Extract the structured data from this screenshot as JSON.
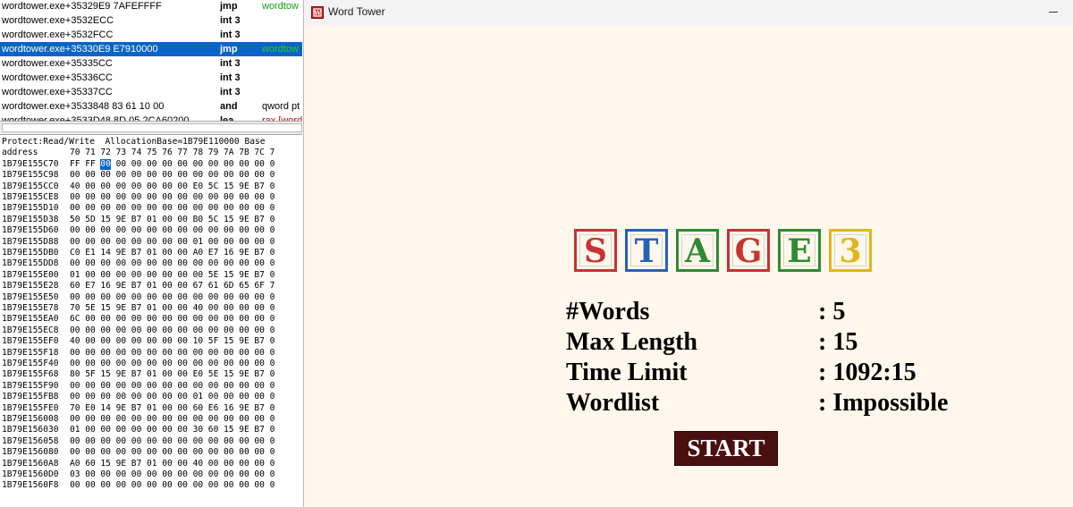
{
  "disassembly": {
    "rows": [
      {
        "address": "wordtower.exe+35329E9 7AFEFFFF",
        "opcode": "jmp",
        "operand": "wordtow",
        "operand_color": "green"
      },
      {
        "address": "wordtower.exe+3532ECC",
        "opcode": "int 3",
        "operand": ""
      },
      {
        "address": "wordtower.exe+3532FCC",
        "opcode": "int 3",
        "operand": ""
      },
      {
        "address": "wordtower.exe+35330E9 E7910000",
        "opcode": "jmp",
        "operand": "wordtow",
        "operand_color": "green",
        "selected": true
      },
      {
        "address": "wordtower.exe+35335CC",
        "opcode": "int 3",
        "operand": ""
      },
      {
        "address": "wordtower.exe+35336CC",
        "opcode": "int 3",
        "operand": ""
      },
      {
        "address": "wordtower.exe+35337CC",
        "opcode": "int 3",
        "operand": ""
      },
      {
        "address": "wordtower.exe+3533848 83 61 10 00",
        "opcode": "and",
        "operand": "qword pt"
      },
      {
        "address": "wordtower.exe+3533D48 8D 05 2CA60200",
        "opcode": "lea",
        "operand": "rax,[word",
        "operand_color": "red"
      }
    ]
  },
  "hexview": {
    "protect_line": "Protect:Read/Write  AllocationBase=1B79E110000 Base",
    "header_label": "address",
    "columns": [
      "70",
      "71",
      "72",
      "73",
      "74",
      "75",
      "76",
      "77",
      "78",
      "79",
      "7A",
      "7B",
      "7C",
      "7"
    ],
    "highlight": {
      "row": 0,
      "col": 2
    },
    "rows": [
      {
        "addr": "1B79E155C70",
        "bytes": [
          "FF",
          "FF",
          "00",
          "00",
          "00",
          "00",
          "00",
          "00",
          "00",
          "00",
          "00",
          "00",
          "00",
          "0"
        ]
      },
      {
        "addr": "1B79E155C98",
        "bytes": [
          "00",
          "00",
          "00",
          "00",
          "00",
          "00",
          "00",
          "00",
          "00",
          "00",
          "00",
          "00",
          "00",
          "0"
        ]
      },
      {
        "addr": "1B79E155CC0",
        "bytes": [
          "40",
          "00",
          "00",
          "00",
          "00",
          "00",
          "00",
          "00",
          "E0",
          "5C",
          "15",
          "9E",
          "B7",
          "0"
        ]
      },
      {
        "addr": "1B79E155CE8",
        "bytes": [
          "00",
          "00",
          "00",
          "00",
          "00",
          "00",
          "00",
          "00",
          "00",
          "00",
          "00",
          "00",
          "00",
          "0"
        ]
      },
      {
        "addr": "1B79E155D10",
        "bytes": [
          "00",
          "00",
          "00",
          "00",
          "00",
          "00",
          "00",
          "00",
          "00",
          "00",
          "00",
          "00",
          "00",
          "0"
        ]
      },
      {
        "addr": "1B79E155D38",
        "bytes": [
          "50",
          "5D",
          "15",
          "9E",
          "B7",
          "01",
          "00",
          "00",
          "B0",
          "5C",
          "15",
          "9E",
          "B7",
          "0"
        ]
      },
      {
        "addr": "1B79E155D60",
        "bytes": [
          "00",
          "00",
          "00",
          "00",
          "00",
          "00",
          "00",
          "00",
          "00",
          "00",
          "00",
          "00",
          "00",
          "0"
        ]
      },
      {
        "addr": "1B79E155D88",
        "bytes": [
          "00",
          "00",
          "00",
          "00",
          "00",
          "00",
          "00",
          "00",
          "01",
          "00",
          "00",
          "00",
          "00",
          "0"
        ]
      },
      {
        "addr": "1B79E155DB0",
        "bytes": [
          "C0",
          "E1",
          "14",
          "9E",
          "B7",
          "01",
          "00",
          "00",
          "A0",
          "E7",
          "16",
          "9E",
          "B7",
          "0"
        ]
      },
      {
        "addr": "1B79E155DD8",
        "bytes": [
          "00",
          "00",
          "00",
          "00",
          "00",
          "00",
          "00",
          "00",
          "00",
          "00",
          "00",
          "00",
          "00",
          "0"
        ]
      },
      {
        "addr": "1B79E155E00",
        "bytes": [
          "01",
          "00",
          "00",
          "00",
          "00",
          "00",
          "00",
          "00",
          "00",
          "5E",
          "15",
          "9E",
          "B7",
          "0"
        ]
      },
      {
        "addr": "1B79E155E28",
        "bytes": [
          "60",
          "E7",
          "16",
          "9E",
          "B7",
          "01",
          "00",
          "00",
          "67",
          "61",
          "6D",
          "65",
          "6F",
          "7"
        ]
      },
      {
        "addr": "1B79E155E50",
        "bytes": [
          "00",
          "00",
          "00",
          "00",
          "00",
          "00",
          "00",
          "00",
          "00",
          "00",
          "00",
          "00",
          "00",
          "0"
        ]
      },
      {
        "addr": "1B79E155E78",
        "bytes": [
          "70",
          "5E",
          "15",
          "9E",
          "B7",
          "01",
          "00",
          "00",
          "40",
          "00",
          "00",
          "00",
          "00",
          "0"
        ]
      },
      {
        "addr": "1B79E155EA0",
        "bytes": [
          "6C",
          "00",
          "00",
          "00",
          "00",
          "00",
          "00",
          "00",
          "00",
          "00",
          "00",
          "00",
          "00",
          "0"
        ]
      },
      {
        "addr": "1B79E155EC8",
        "bytes": [
          "00",
          "00",
          "00",
          "00",
          "00",
          "00",
          "00",
          "00",
          "00",
          "00",
          "00",
          "00",
          "00",
          "0"
        ]
      },
      {
        "addr": "1B79E155EF0",
        "bytes": [
          "40",
          "00",
          "00",
          "00",
          "00",
          "00",
          "00",
          "00",
          "10",
          "5F",
          "15",
          "9E",
          "B7",
          "0"
        ]
      },
      {
        "addr": "1B79E155F18",
        "bytes": [
          "00",
          "00",
          "00",
          "00",
          "00",
          "00",
          "00",
          "00",
          "00",
          "00",
          "00",
          "00",
          "00",
          "0"
        ]
      },
      {
        "addr": "1B79E155F40",
        "bytes": [
          "00",
          "00",
          "00",
          "00",
          "00",
          "00",
          "00",
          "00",
          "00",
          "00",
          "00",
          "00",
          "00",
          "0"
        ]
      },
      {
        "addr": "1B79E155F68",
        "bytes": [
          "80",
          "5F",
          "15",
          "9E",
          "B7",
          "01",
          "00",
          "00",
          "E0",
          "5E",
          "15",
          "9E",
          "B7",
          "0"
        ]
      },
      {
        "addr": "1B79E155F90",
        "bytes": [
          "00",
          "00",
          "00",
          "00",
          "00",
          "00",
          "00",
          "00",
          "00",
          "00",
          "00",
          "00",
          "00",
          "0"
        ]
      },
      {
        "addr": "1B79E155FB8",
        "bytes": [
          "00",
          "00",
          "00",
          "00",
          "00",
          "00",
          "00",
          "00",
          "01",
          "00",
          "00",
          "00",
          "00",
          "0"
        ]
      },
      {
        "addr": "1B79E155FE0",
        "bytes": [
          "70",
          "E0",
          "14",
          "9E",
          "B7",
          "01",
          "00",
          "00",
          "60",
          "E6",
          "16",
          "9E",
          "B7",
          "0"
        ]
      },
      {
        "addr": "1B79E156008",
        "bytes": [
          "00",
          "00",
          "00",
          "00",
          "00",
          "00",
          "00",
          "00",
          "00",
          "00",
          "00",
          "00",
          "00",
          "0"
        ]
      },
      {
        "addr": "1B79E156030",
        "bytes": [
          "01",
          "00",
          "00",
          "00",
          "00",
          "00",
          "00",
          "00",
          "30",
          "60",
          "15",
          "9E",
          "B7",
          "0"
        ]
      },
      {
        "addr": "1B79E156058",
        "bytes": [
          "00",
          "00",
          "00",
          "00",
          "00",
          "00",
          "00",
          "00",
          "00",
          "00",
          "00",
          "00",
          "00",
          "0"
        ]
      },
      {
        "addr": "1B79E156080",
        "bytes": [
          "00",
          "00",
          "00",
          "00",
          "00",
          "00",
          "00",
          "00",
          "00",
          "00",
          "00",
          "00",
          "00",
          "0"
        ]
      },
      {
        "addr": "1B79E1560A8",
        "bytes": [
          "A0",
          "60",
          "15",
          "9E",
          "B7",
          "01",
          "00",
          "00",
          "40",
          "00",
          "00",
          "00",
          "00",
          "0"
        ]
      },
      {
        "addr": "1B79E1560D0",
        "bytes": [
          "03",
          "00",
          "00",
          "00",
          "00",
          "00",
          "00",
          "00",
          "00",
          "00",
          "00",
          "00",
          "00",
          "0"
        ]
      },
      {
        "addr": "1B79E1560F8",
        "bytes": [
          "00",
          "00",
          "00",
          "00",
          "00",
          "00",
          "00",
          "00",
          "00",
          "00",
          "00",
          "00",
          "00",
          "0"
        ]
      }
    ]
  },
  "window": {
    "title": "Word Tower",
    "minimize_label": "—"
  },
  "stage": {
    "blocks": [
      {
        "letter": "S",
        "color": "#c83232"
      },
      {
        "letter": "T",
        "color": "#2662b8"
      },
      {
        "letter": "A",
        "color": "#2f8a32"
      },
      {
        "letter": "G",
        "color": "#c83232"
      },
      {
        "letter": "E",
        "color": "#2f8a32"
      },
      {
        "letter": "3",
        "color": "#e3b51c"
      }
    ]
  },
  "info": [
    {
      "label": "#Words",
      "value": ": 5"
    },
    {
      "label": "Max Length",
      "value": ": 15"
    },
    {
      "label": "Time Limit",
      "value": ": 1092:15"
    },
    {
      "label": "Wordlist",
      "value": ": Impossible"
    }
  ],
  "start_label": "START"
}
